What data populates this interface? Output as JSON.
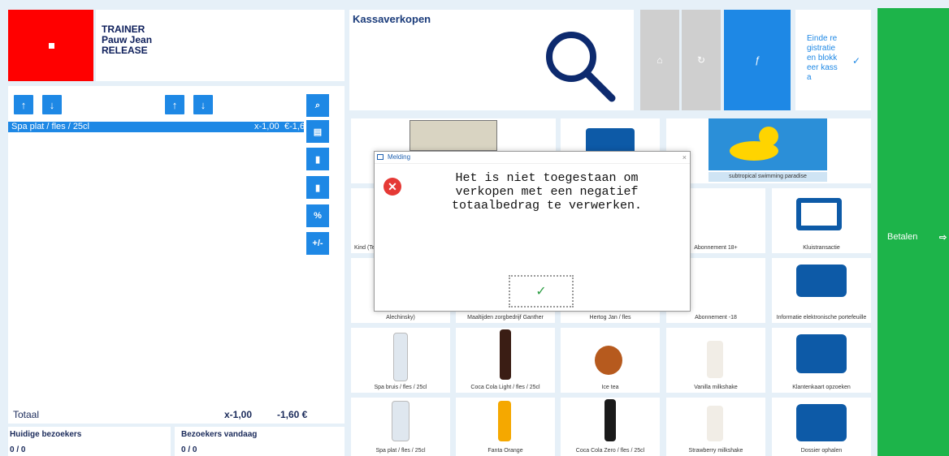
{
  "user": {
    "role": "TRAINER",
    "name": "Pauw Jean",
    "env": "RELEASE"
  },
  "order": {
    "line": {
      "item": "Spa plat / fles / 25cl",
      "qty": "x-1,00",
      "price": "€-1,60"
    },
    "total_label": "Totaal",
    "total_qty": "x-1,00",
    "total_price": "-1,60 €"
  },
  "visitors": {
    "current_label": "Huidige bezoekers",
    "current_value": "0 / 0",
    "today_label": "Bezoekers vandaag",
    "today_value": "0 / 0"
  },
  "header": {
    "title": "Kassaverkopen",
    "end_label": "Einde registratie en blokkeer kassa"
  },
  "buttons": {
    "up": "↑",
    "down": "↓",
    "side": [
      "🔍",
      "▣",
      "🗑",
      "🗑",
      "%",
      "+/-"
    ],
    "home": "⌂",
    "refresh": "↻",
    "florin": "ƒ"
  },
  "tiles": {
    "r1": [
      "",
      "",
      "subtropical swimming paradise"
    ],
    "r2": [
      "Kind (Te",
      "Abonnement 18+",
      "Kluistransactie"
    ],
    "r3": [
      "Alechinsky)",
      "Maaltijden zorgbedrijf Ganther",
      "Hertog Jan / fles",
      "Abonnement -18",
      "Informatie elektronische portefeuille"
    ],
    "r4": [
      "Spa bruis / fles / 25cl",
      "Coca Cola Light / fles / 25cl",
      "Ice tea",
      "Vanilla milkshake",
      "Klantenkaart opzoeken"
    ],
    "r5": [
      "Spa plat / fles / 25cl",
      "Fanta Orange",
      "Coca Cola Zero / fles / 25cl",
      "Strawberry milkshake",
      "Dossier ophalen"
    ]
  },
  "pay": {
    "label": "Betalen"
  },
  "dialog": {
    "title": "Melding",
    "message": "Het is niet toegestaan om verkopen met een negatief totaalbedrag te verwerken.",
    "close": "×"
  },
  "colors": {
    "accent": "#1e88e5",
    "pay": "#1db44a",
    "red": "#ff0000",
    "navy": "#1a3b7a"
  }
}
